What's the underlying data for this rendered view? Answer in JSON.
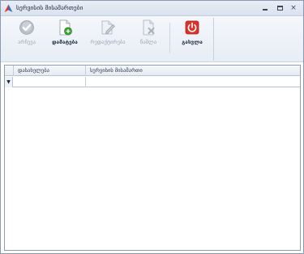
{
  "window": {
    "title": "სერვისის მისამართები",
    "min_glyph": "",
    "close_glyph": "×"
  },
  "toolbar": {
    "items": [
      {
        "label": "არჩევა",
        "icon": "check-circle-icon",
        "enabled": false
      },
      {
        "label": "დამატება",
        "icon": "add-document-icon",
        "enabled": true
      },
      {
        "label": "რედაქტირება",
        "icon": "edit-document-icon",
        "enabled": false
      },
      {
        "label": "წაშლა",
        "icon": "delete-document-icon",
        "enabled": false
      },
      {
        "label": "გასვლა",
        "icon": "power-icon",
        "enabled": true
      }
    ]
  },
  "grid": {
    "columns": [
      {
        "label": "დასახელება"
      },
      {
        "label": "სერვისის მისამართი"
      }
    ],
    "new_row_indicator": "▼",
    "rows": [
      [
        "",
        ""
      ]
    ]
  },
  "colors": {
    "accent_red": "#d9332b",
    "add_green": "#3aa335",
    "disabled_gray": "#a7b1bd"
  }
}
